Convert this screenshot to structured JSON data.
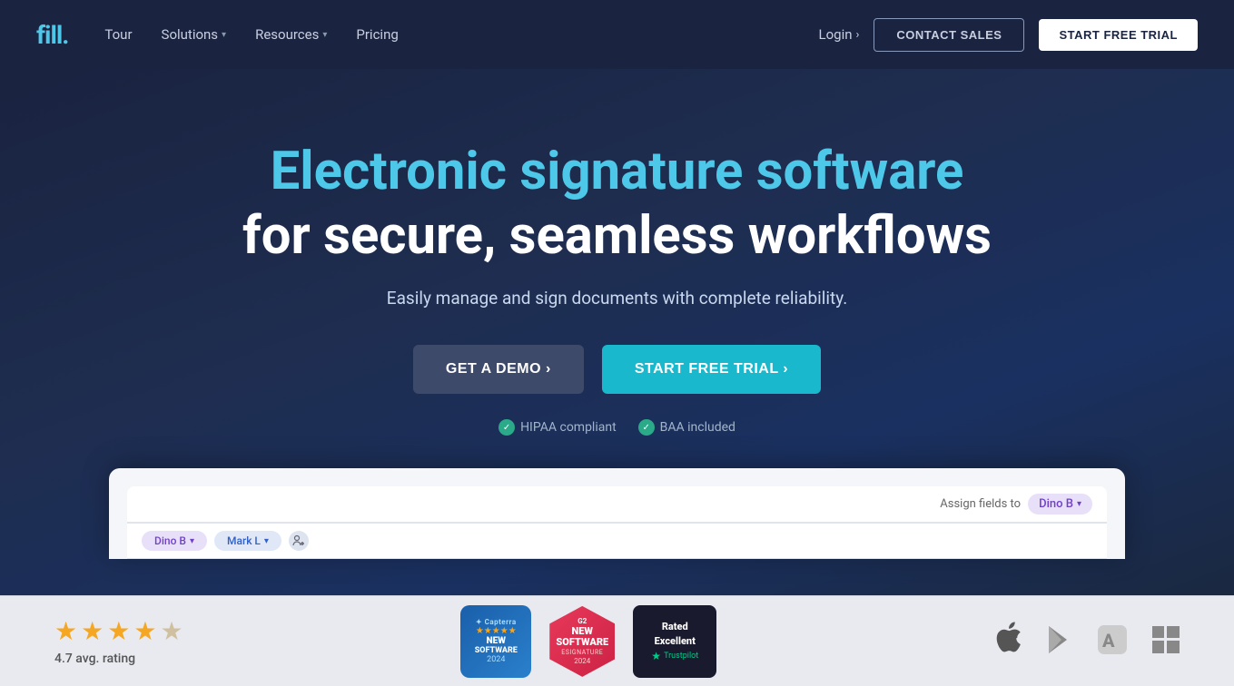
{
  "brand": {
    "logo_text": "fill.",
    "logo_accent": "fi"
  },
  "navbar": {
    "tour_label": "Tour",
    "solutions_label": "Solutions",
    "resources_label": "Resources",
    "pricing_label": "Pricing",
    "login_label": "Login",
    "login_arrow": "›",
    "contact_sales_label": "CONTACT SALES",
    "start_trial_label": "START FREE TRIAL"
  },
  "hero": {
    "title_line1": "Electronic signature software",
    "title_line2": "for secure, seamless workflows",
    "subtitle": "Easily manage and sign documents with complete reliability.",
    "get_demo_label": "GET A DEMO ›",
    "start_trial_label": "START FREE TRIAL ›",
    "badge1": "HIPAA compliant",
    "badge2": "BAA included"
  },
  "app_preview": {
    "assign_label": "Assign fields to",
    "assign_user": "Dino B",
    "tab1_label": "Dino B",
    "tab2_label": "Mark L"
  },
  "bottom_bar": {
    "rating_value": "4.7 avg. rating",
    "stars": [
      true,
      true,
      true,
      true,
      false
    ],
    "capterra_label": "NEW SOFTWARE",
    "capterra_year": "2024",
    "g2_label": "NEW SOFTWARE",
    "g2_sub": "esignature",
    "g2_year": "2024",
    "trustpilot_label1": "Rated",
    "trustpilot_label2": "Excellent",
    "trustpilot_brand": "Trustpilot"
  }
}
